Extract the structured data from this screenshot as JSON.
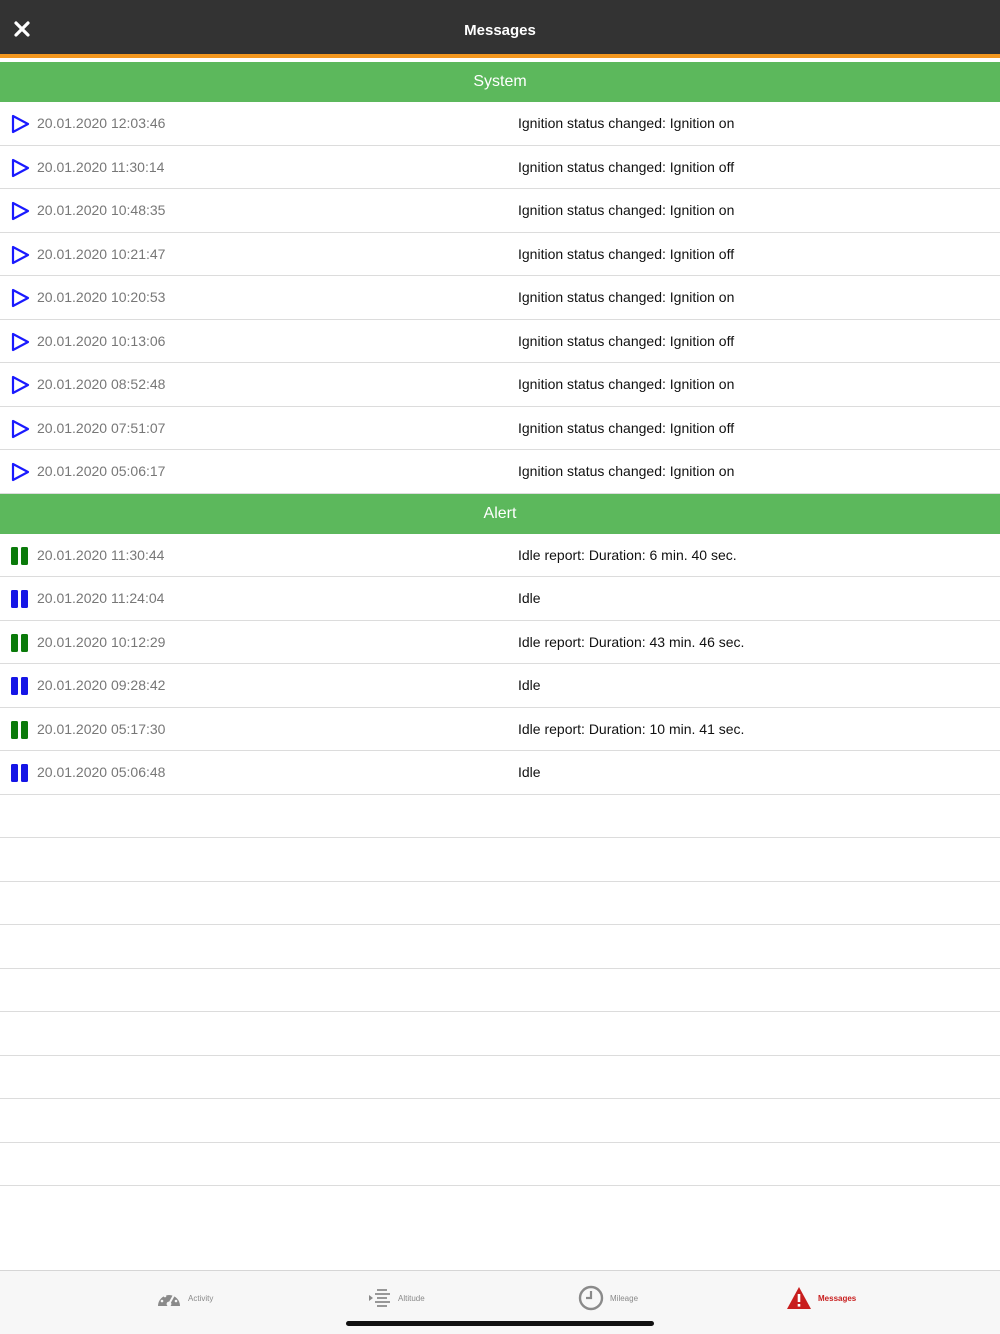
{
  "header": {
    "title": "Messages"
  },
  "sections": {
    "system": {
      "title": "System",
      "rows": [
        {
          "time": "20.01.2020 12:03:46",
          "text": "Ignition status changed: Ignition on"
        },
        {
          "time": "20.01.2020 11:30:14",
          "text": "Ignition status changed: Ignition off"
        },
        {
          "time": "20.01.2020 10:48:35",
          "text": "Ignition status changed: Ignition on"
        },
        {
          "time": "20.01.2020 10:21:47",
          "text": "Ignition status changed: Ignition off"
        },
        {
          "time": "20.01.2020 10:20:53",
          "text": "Ignition status changed: Ignition on"
        },
        {
          "time": "20.01.2020 10:13:06",
          "text": "Ignition status changed: Ignition off"
        },
        {
          "time": "20.01.2020 08:52:48",
          "text": "Ignition status changed: Ignition on"
        },
        {
          "time": "20.01.2020 07:51:07",
          "text": "Ignition status changed: Ignition off"
        },
        {
          "time": "20.01.2020 05:06:17",
          "text": "Ignition status changed: Ignition on"
        }
      ]
    },
    "alert": {
      "title": "Alert",
      "rows": [
        {
          "time": "20.01.2020 11:30:44",
          "text": "Idle report: Duration: 6 min. 40 sec.",
          "icon": "pause-green-icon"
        },
        {
          "time": "20.01.2020 11:24:04",
          "text": "Idle",
          "icon": "pause-blue-icon"
        },
        {
          "time": "20.01.2020 10:12:29",
          "text": "Idle report: Duration: 43 min. 46 sec.",
          "icon": "pause-green-icon"
        },
        {
          "time": "20.01.2020 09:28:42",
          "text": "Idle",
          "icon": "pause-blue-icon"
        },
        {
          "time": "20.01.2020 05:17:30",
          "text": "Idle report: Duration: 10 min. 41 sec.",
          "icon": "pause-green-icon"
        },
        {
          "time": "20.01.2020 05:06:48",
          "text": "Idle",
          "icon": "pause-blue-icon"
        }
      ]
    }
  },
  "tabs": [
    {
      "label": "Activity",
      "icon": "speedometer-icon"
    },
    {
      "label": "Altitude",
      "icon": "altitude-icon"
    },
    {
      "label": "Mileage",
      "icon": "clock-icon"
    },
    {
      "label": "Messages",
      "icon": "warning-icon",
      "active": true
    }
  ],
  "colors": {
    "header_bg": "#333333",
    "header_accent": "#f3971f",
    "section_bg": "#5cb85c",
    "play_icon": "#1a1aff",
    "pause_green": "#0a7a0a",
    "pause_blue": "#1515e6",
    "active_tab": "#c81e1e"
  }
}
